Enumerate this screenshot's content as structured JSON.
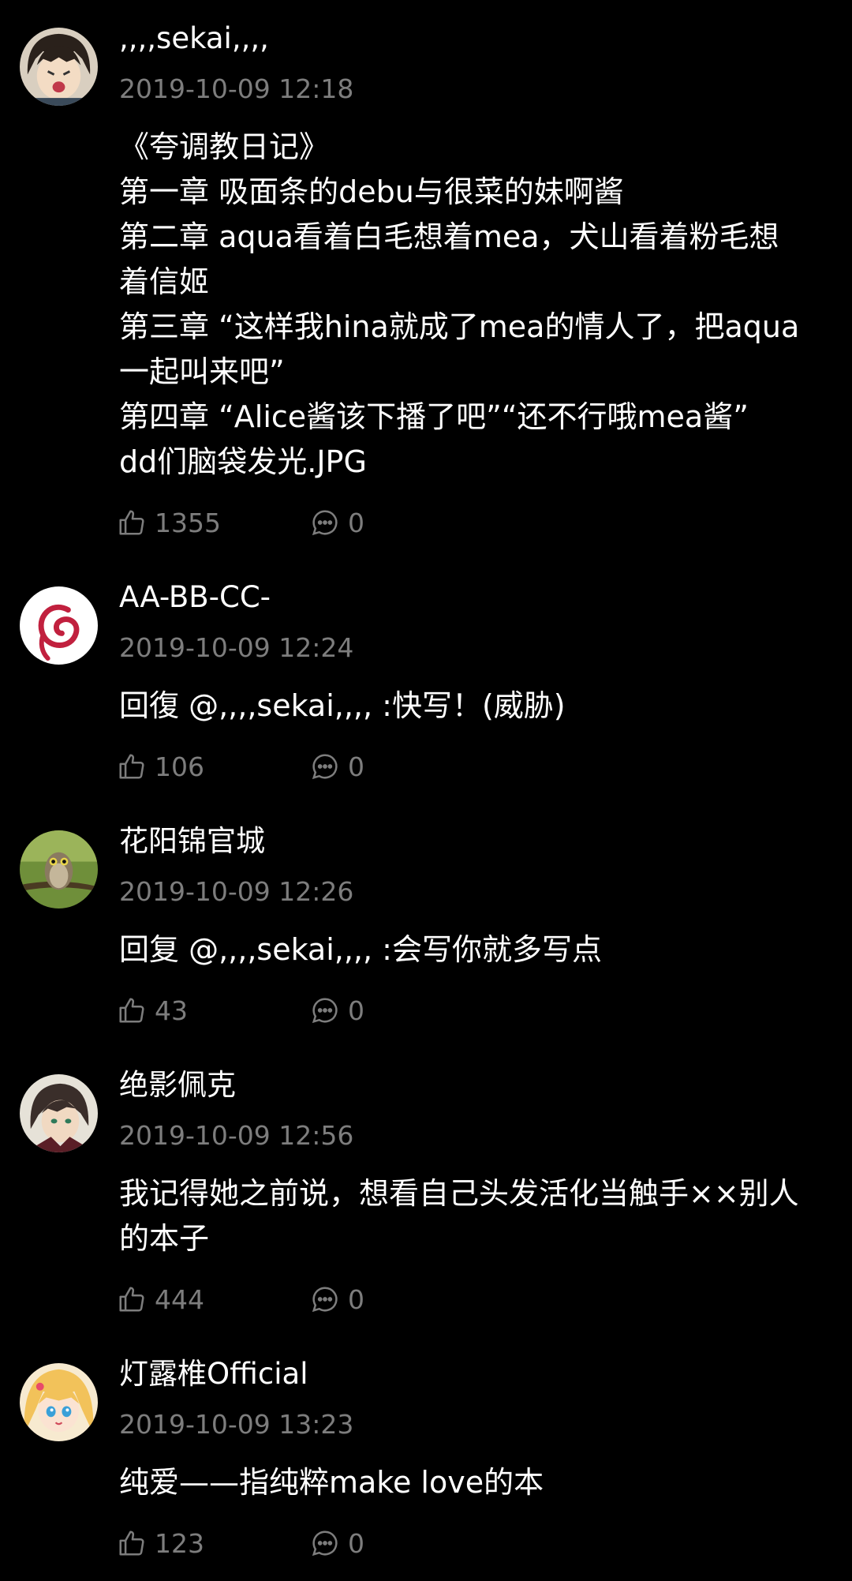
{
  "colors": {
    "background": "#000000",
    "text_primary": "#ffffff",
    "text_secondary": "#7d7d7d"
  },
  "comments": [
    {
      "username": ",,,,sekai,,,,",
      "timestamp": "2019-10-09 12:18",
      "lines": [
        "《夸调教日记》",
        "第一章  吸面条的debu与很菜的妹啊酱",
        "第二章  aqua看着白毛想着mea，犬山看着粉毛想",
        "着信姬",
        "第三章  “这样我hina就成了mea的情人了，把aqua",
        "一起叫来吧”",
        "第四章  “Alice酱该下播了吧”“还不行哦mea酱”",
        "dd们脑袋发光.JPG"
      ],
      "likes": "1355",
      "replies": "0",
      "avatar_icon": "anime-boy-avatar-icon"
    },
    {
      "username": "AA-BB-CC-",
      "timestamp": "2019-10-09 12:24",
      "lines": [
        "回復 @,,,,sekai,,,, :快写！(威胁)"
      ],
      "likes": "106",
      "replies": "0",
      "avatar_icon": "debian-swirl-avatar-icon"
    },
    {
      "username": "花阳锦官城",
      "timestamp": "2019-10-09 12:26",
      "lines": [
        "回复 @,,,,sekai,,,, :会写你就多写点"
      ],
      "likes": "43",
      "replies": "0",
      "avatar_icon": "owl-avatar-icon"
    },
    {
      "username": "绝影佩克",
      "timestamp": "2019-10-09 12:56",
      "lines": [
        "我记得她之前说，想看自己头发活化当触手××别人",
        "的本子"
      ],
      "likes": "444",
      "replies": "0",
      "avatar_icon": "anime-character-avatar-icon"
    },
    {
      "username": "灯露椎Official",
      "timestamp": "2019-10-09 13:23",
      "lines": [
        "纯爱——指纯粹make love的本"
      ],
      "likes": "123",
      "replies": "0",
      "avatar_icon": "blonde-anime-girl-avatar-icon"
    }
  ]
}
